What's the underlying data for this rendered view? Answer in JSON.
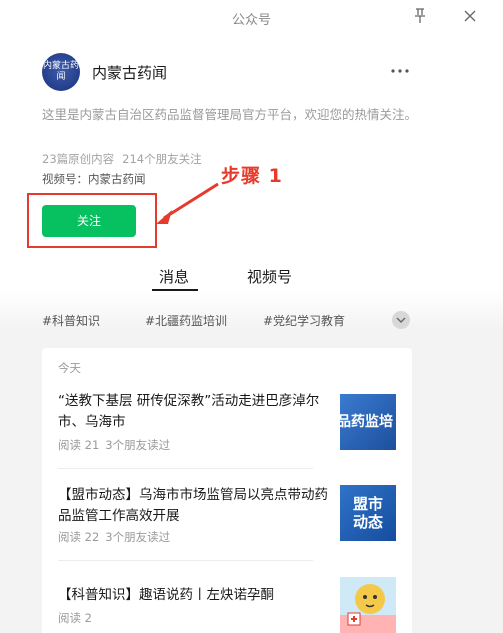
{
  "window": {
    "title": "公众号"
  },
  "account": {
    "avatar_text": "内蒙古药闻",
    "name": "内蒙古药闻",
    "description": "这里是内蒙古自治区药品监督管理局官方平台，欢迎您的热情关注。",
    "original_count": "23篇原创内容",
    "friends_following": "214个朋友关注",
    "video_account": "视频号：内蒙古药闻",
    "follow_label": "关注"
  },
  "annotation": {
    "label": "步骤 1",
    "color": "#e53b2c"
  },
  "tabs": [
    {
      "label": "消息",
      "active": true
    },
    {
      "label": "视频号",
      "active": false
    }
  ],
  "tags": [
    "#科普知识",
    "#北疆药监培训",
    "#党纪学习教育"
  ],
  "feed": {
    "day_label": "今天",
    "articles": [
      {
        "title": "“送教下基层 研传促深教”活动走进巴彦淖尔市、乌海市",
        "reads": "阅读 21",
        "friends": "3个朋友读过",
        "thumb_text": "品药监培",
        "thumb_color": "#2a63b6"
      },
      {
        "title": "【盟市动态】乌海市市场监管局以亮点带动药品监管工作高效开展",
        "reads": "阅读 22",
        "friends": "3个朋友读过",
        "thumb_text": "盟市动态",
        "thumb_color": "#1f5fb5"
      },
      {
        "title": "【科普知识】趣语说药丨左炔诺孕酮",
        "reads": "阅读 2",
        "friends": "",
        "thumb_text": "",
        "thumb_color": "#f4c94a"
      }
    ]
  },
  "colors": {
    "accent": "#07c160",
    "annotation": "#e53b2c",
    "text_muted": "#9a9a9a"
  },
  "icons": [
    "pin-icon",
    "close-icon",
    "more-icon",
    "chevron-down-icon",
    "arrow-icon"
  ]
}
